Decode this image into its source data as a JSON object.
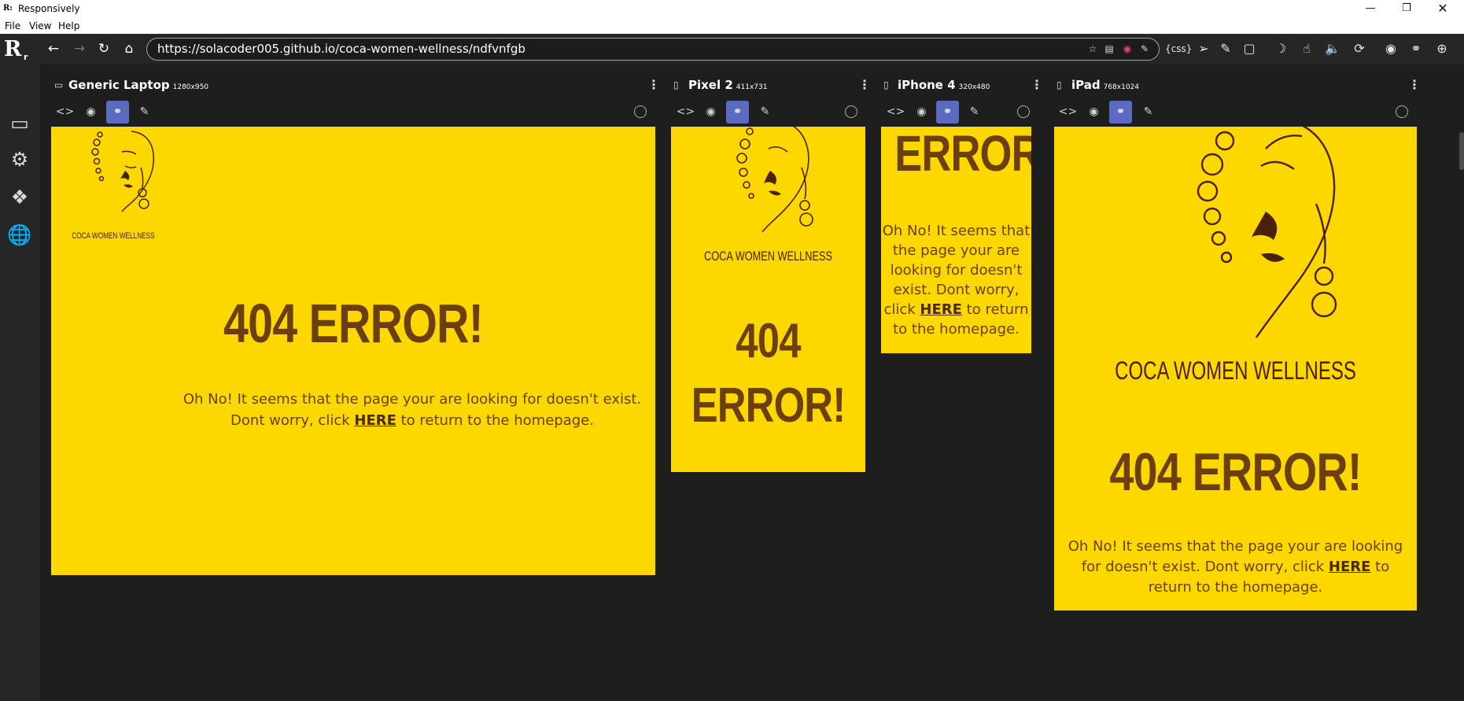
{
  "window": {
    "title": "Responsively",
    "app_icon": "R",
    "controls": [
      "minimize-icon",
      "restore-icon",
      "close-icon"
    ]
  },
  "menu": [
    "File",
    "View",
    "Help"
  ],
  "toolbar": {
    "url": "https://solacoder005.github.io/coca-women-wellness/ndfvnfgb",
    "css_label": "{css}",
    "logo_text": "R",
    "logo_sub": "r"
  },
  "devices": [
    {
      "name": "Generic Laptop",
      "size": "1280x950"
    },
    {
      "name": "Pixel 2",
      "size": "411x731"
    },
    {
      "name": "iPhone 4",
      "size": "320x480"
    },
    {
      "name": "iPad",
      "size": "768x1024"
    }
  ],
  "page": {
    "brand": "COCA WOMEN WELLNESS",
    "heading": "404 ERROR!",
    "heading_line1": "404",
    "heading_line2": "ERROR!",
    "msg_before": "Oh No! It seems that the page your are looking for doesn't exist. Dont worry, click ",
    "link": "HERE",
    "msg_after": " to return to the homepage."
  },
  "colors": {
    "page_bg": "#fdd700",
    "heading": "#6b3f0e",
    "app_bg": "#1e1e1e",
    "active_tool": "#5b6bbf"
  }
}
